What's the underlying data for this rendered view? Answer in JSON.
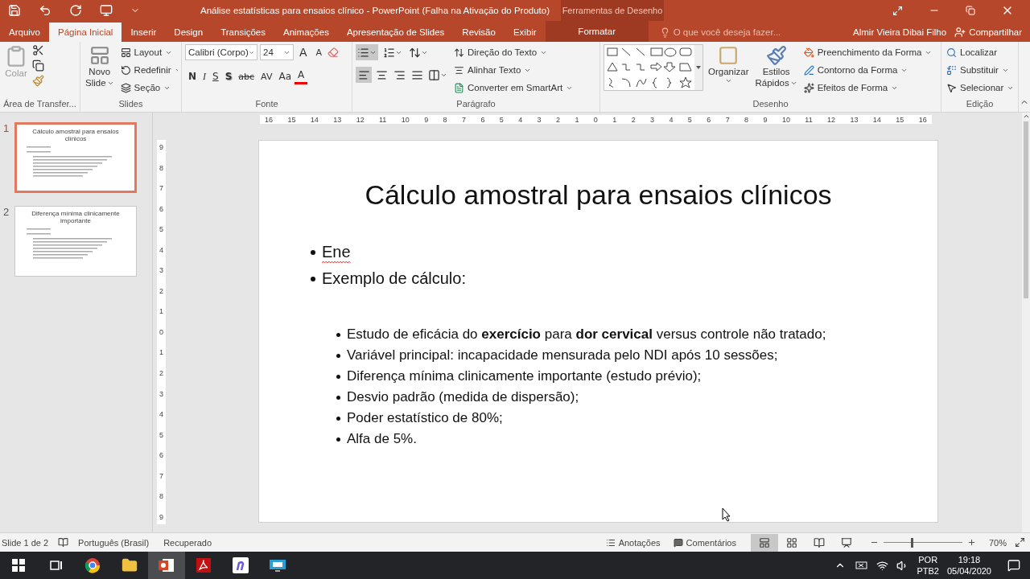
{
  "title_bar": {
    "title": "Análise estatísticas para ensaios clínico - PowerPoint (Falha na Ativação do Produto)",
    "contextual_group": "Ferramentas de Desenho"
  },
  "tabs": [
    {
      "label": "Arquivo",
      "selected": false,
      "kind": "file"
    },
    {
      "label": "Página Inicial",
      "selected": true,
      "kind": "tab"
    },
    {
      "label": "Inserir",
      "selected": false,
      "kind": "tab"
    },
    {
      "label": "Design",
      "selected": false,
      "kind": "tab"
    },
    {
      "label": "Transições",
      "selected": false,
      "kind": "tab"
    },
    {
      "label": "Animações",
      "selected": false,
      "kind": "tab"
    },
    {
      "label": "Apresentação de Slides",
      "selected": false,
      "kind": "tab"
    },
    {
      "label": "Revisão",
      "selected": false,
      "kind": "tab"
    },
    {
      "label": "Exibir",
      "selected": false,
      "kind": "tab"
    },
    {
      "label": "Formatar",
      "selected": false,
      "kind": "contextual"
    }
  ],
  "tell_me": {
    "placeholder": "O que você deseja fazer..."
  },
  "user": "Almir Vieira Dibai Filho",
  "share": "Compartilhar",
  "ribbon": {
    "clipboard": {
      "paste": "Colar",
      "label": "Área de Transfer..."
    },
    "slides": {
      "new_slide": [
        "Novo",
        "Slide"
      ],
      "items": [
        "Layout",
        "Redefinir",
        "Seção"
      ],
      "label": "Slides"
    },
    "font": {
      "font_name": "Calibri (Corpo)",
      "font_size": "24",
      "grow": "A",
      "shrink": "A",
      "format_buttons": [
        {
          "text": "N",
          "kind": "bold"
        },
        {
          "text": "I",
          "kind": "italic"
        },
        {
          "text": "S",
          "kind": "underline"
        },
        {
          "text": "S",
          "kind": "shadow"
        },
        {
          "text": "abc",
          "kind": "strike"
        },
        {
          "text": "AV",
          "kind": "spacing"
        },
        {
          "text": "Aa",
          "kind": "case"
        },
        {
          "text": "A",
          "kind": "color"
        }
      ],
      "label": "Fonte"
    },
    "paragraph": {
      "items": [
        "Direção do Texto",
        "Alinhar Texto",
        "Converter em SmartArt"
      ],
      "label": "Parágrafo"
    },
    "drawing": {
      "arrange": "Organizar",
      "quick_styles": [
        "Estilos",
        "Rápidos"
      ],
      "items": [
        "Preenchimento da Forma",
        "Contorno da Forma",
        "Efeitos de Forma"
      ],
      "label": "Desenho"
    },
    "editing": {
      "items": [
        "Localizar",
        "Substituir",
        "Selecionar"
      ],
      "label": "Edição"
    }
  },
  "rulers": {
    "horizontal": [
      "16",
      "15",
      "14",
      "13",
      "12",
      "11",
      "10",
      "9",
      "8",
      "7",
      "6",
      "5",
      "4",
      "3",
      "2",
      "1",
      "0",
      "1",
      "2",
      "3",
      "4",
      "5",
      "6",
      "7",
      "8",
      "9",
      "10",
      "11",
      "12",
      "13",
      "14",
      "15",
      "16"
    ],
    "vertical": [
      "9",
      "8",
      "7",
      "6",
      "5",
      "4",
      "3",
      "2",
      "1",
      "0",
      "1",
      "2",
      "3",
      "4",
      "5",
      "6",
      "7",
      "8",
      "9"
    ]
  },
  "thumbnails": [
    {
      "number": "1",
      "title": "Cálculo amostral para  ensaios clínicos",
      "selected": true
    },
    {
      "number": "2",
      "title": "Diferença mínima clinicamente importante",
      "selected": false
    }
  ],
  "slide": {
    "title": "Cálculo amostral para ensaios clínicos",
    "bullets": [
      {
        "text": "Ene",
        "misspelled": true
      },
      {
        "text": "Exemplo de cálculo:",
        "misspelled": false,
        "children": [
          {
            "text": "Estudo de eficácia do **exercício** para **dor cervical** versus controle não tratado;"
          },
          {
            "text": "Variável principal: incapacidade mensurada pelo NDI após 10 sessões;"
          },
          {
            "text": "Diferença mínima clinicamente importante (estudo prévio);"
          },
          {
            "text": "Desvio padrão (medida de dispersão);"
          },
          {
            "text": "Poder estatístico de 80%;"
          },
          {
            "text": "Alfa de 5%."
          }
        ]
      }
    ]
  },
  "status_bar": {
    "slide": "Slide 1 de 2",
    "language": "Português (Brasil)",
    "state": "Recuperado",
    "notes": "Anotações",
    "comments": "Comentários",
    "views": [
      {
        "kind": "normal",
        "selected": true
      },
      {
        "kind": "sorter",
        "selected": false
      },
      {
        "kind": "reading",
        "selected": false
      },
      {
        "kind": "show",
        "selected": false
      }
    ],
    "zoom": {
      "level": 0.35,
      "reading": "70%"
    }
  },
  "taskbar": {
    "apps": [
      {
        "kind": "taskview",
        "selected": false
      },
      {
        "kind": "browser",
        "selected": false
      },
      {
        "kind": "folder",
        "selected": false
      },
      {
        "kind": "powerpoint",
        "selected": true
      },
      {
        "kind": "pdf",
        "selected": false
      },
      {
        "kind": "notes",
        "selected": false
      },
      {
        "kind": "screen",
        "selected": false
      }
    ],
    "language": [
      "POR",
      "PTB2"
    ],
    "time": "19:18",
    "date": "05/04/2020"
  }
}
